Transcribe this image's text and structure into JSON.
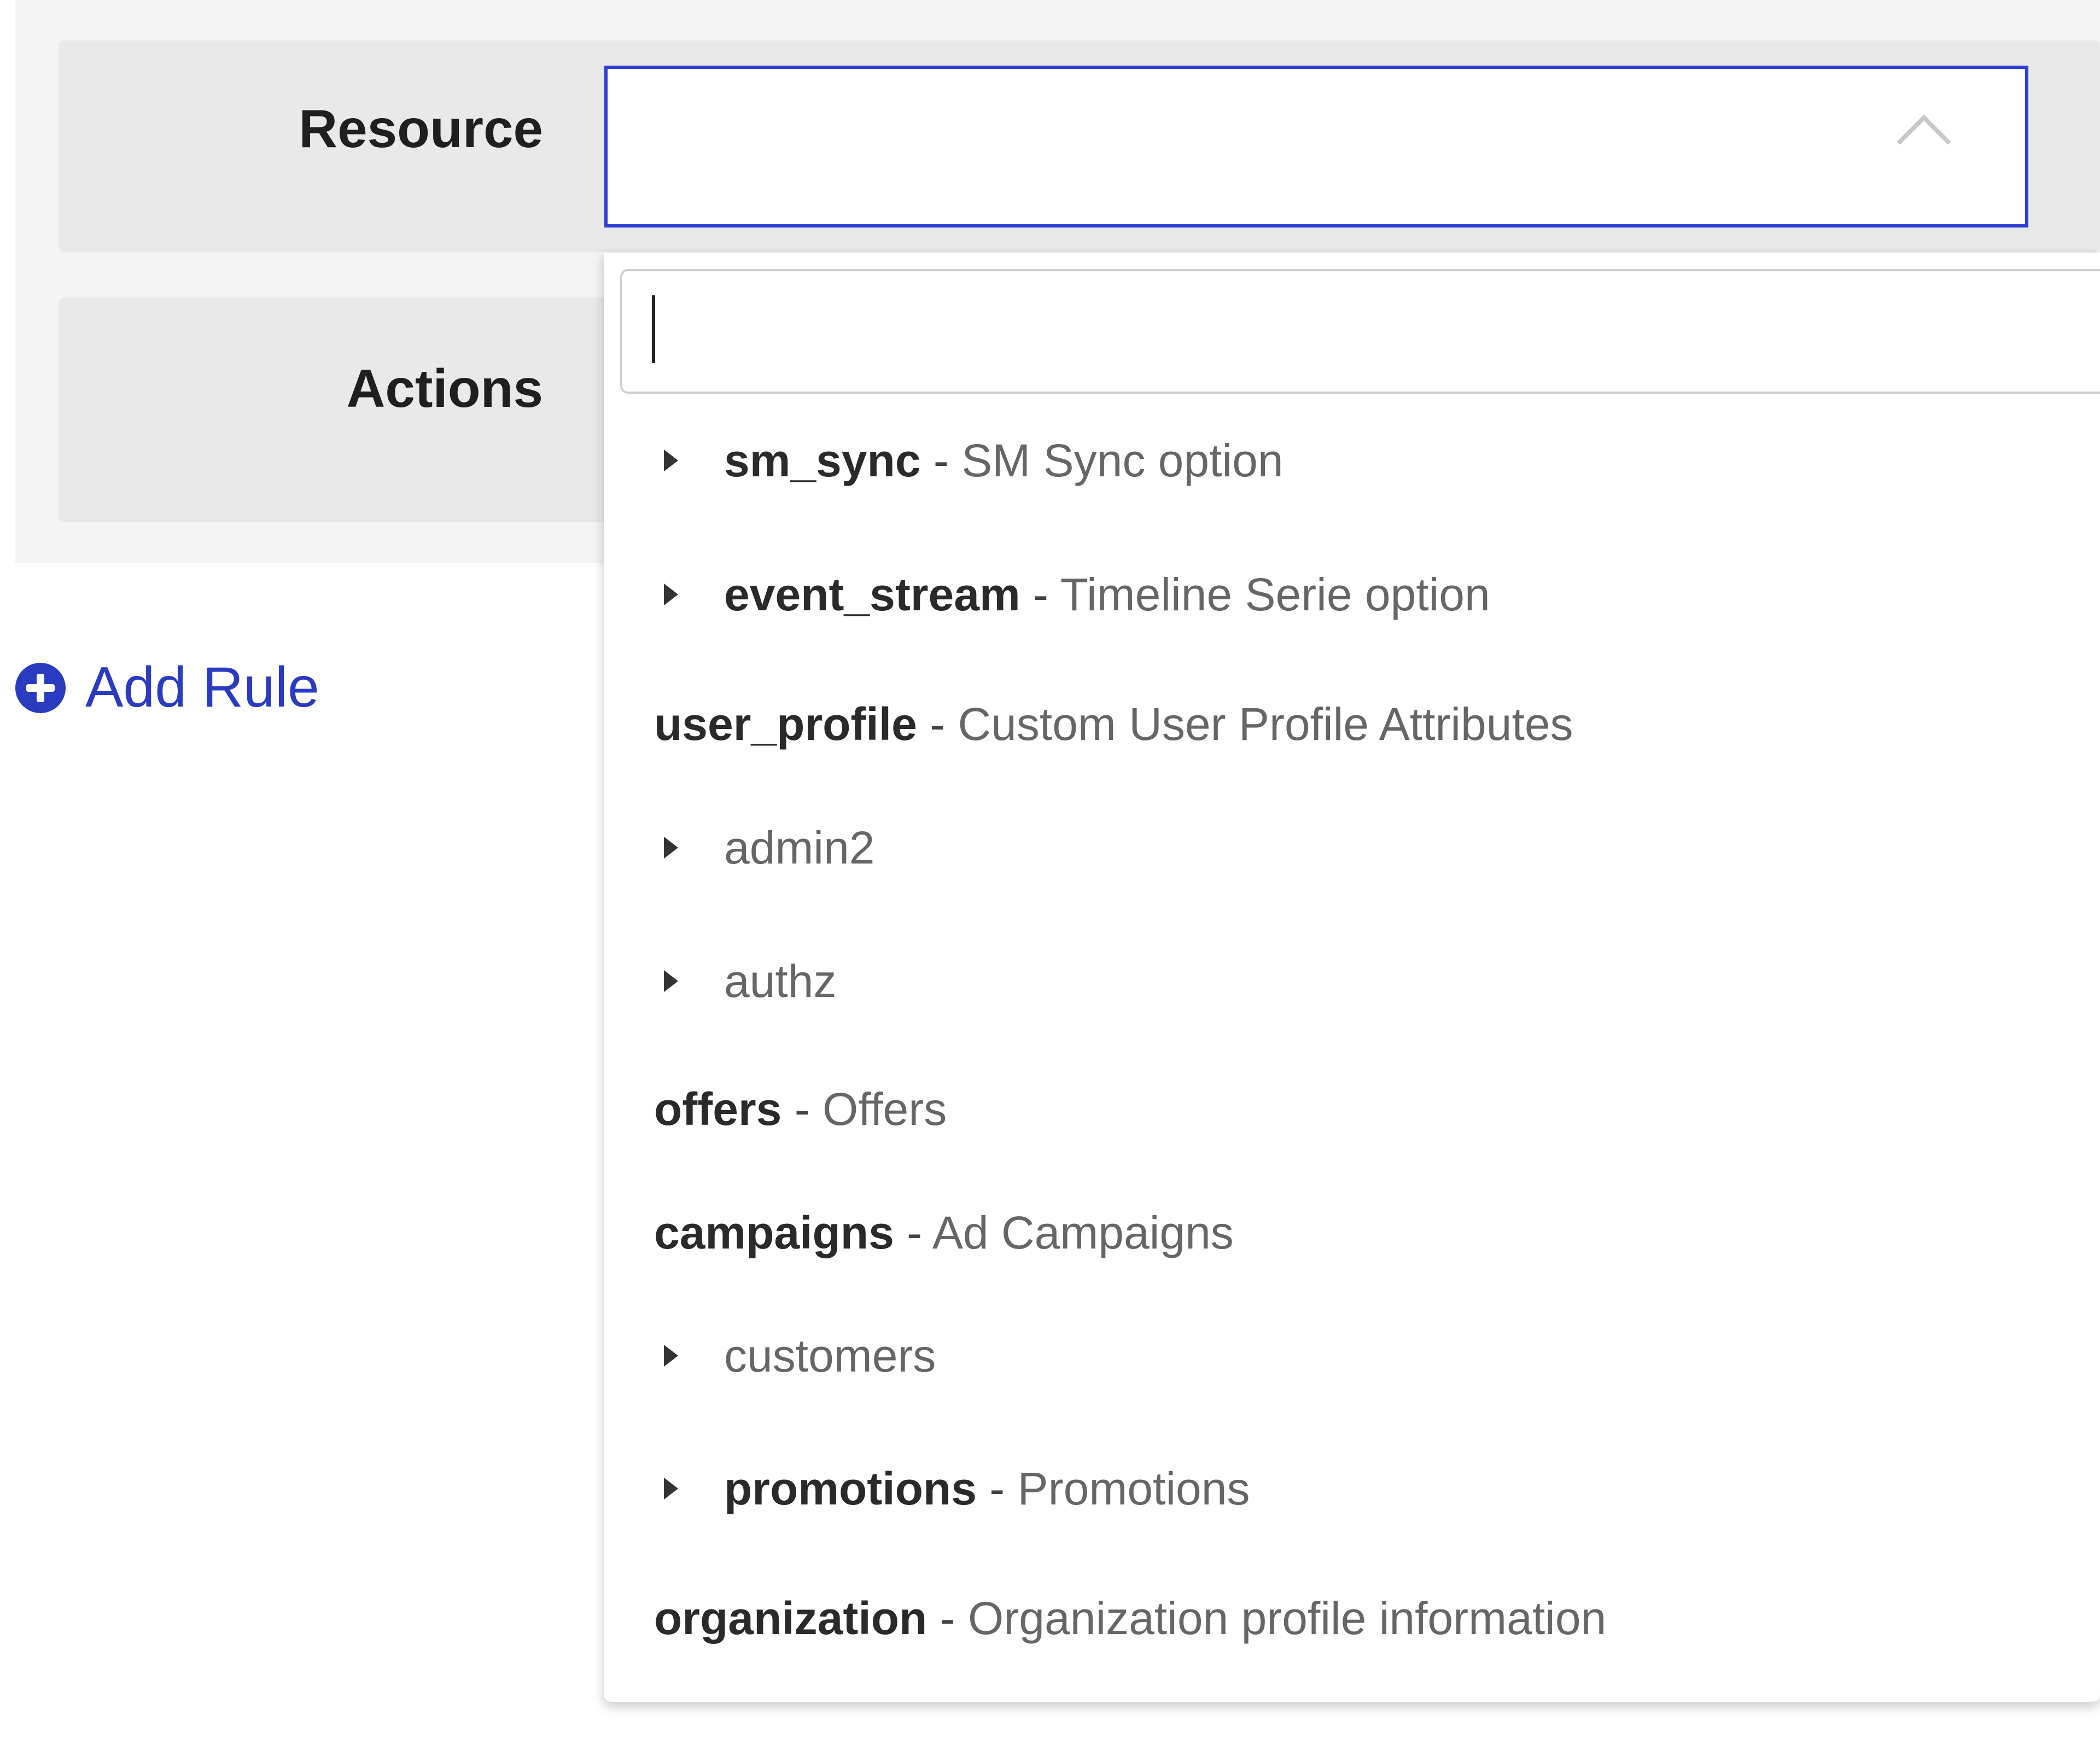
{
  "form": {
    "resource_label": "Resource",
    "actions_label": "Actions",
    "add_rule_label": "Add Rule"
  },
  "dropdown": {
    "search_value": "",
    "options": [
      {
        "key": "sm_sync",
        "separator": " - ",
        "desc": "SM Sync option",
        "expandable": true
      },
      {
        "key": "event_stream",
        "separator": " - ",
        "desc": "Timeline Serie option",
        "expandable": true
      },
      {
        "key": "user_profile",
        "separator": " - ",
        "desc": "Custom User Profile Attributes",
        "expandable": false
      },
      {
        "key": "",
        "separator": "",
        "desc": "admin2",
        "expandable": true
      },
      {
        "key": "",
        "separator": "",
        "desc": "authz",
        "expandable": true
      },
      {
        "key": "offers",
        "separator": " - ",
        "desc": "Offers",
        "expandable": false
      },
      {
        "key": "campaigns",
        "separator": " - ",
        "desc": "Ad Campaigns",
        "expandable": false
      },
      {
        "key": "",
        "separator": "",
        "desc": "customers",
        "expandable": true
      },
      {
        "key": "promotions",
        "separator": " - ",
        "desc": "Promotions",
        "expandable": true
      },
      {
        "key": "organization",
        "separator": " - ",
        "desc": "Organization profile information",
        "expandable": false
      }
    ]
  },
  "icons": {
    "chevron": "chevron-up-icon",
    "add": "plus-circle-icon",
    "expand": "caret-right-icon"
  },
  "colors": {
    "accent": "#2a3bc0",
    "focus_border": "#2f3fd0"
  }
}
